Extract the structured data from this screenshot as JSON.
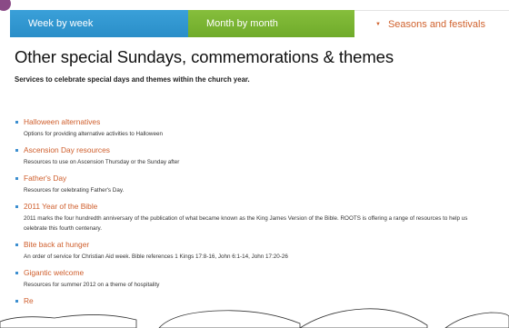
{
  "tabs": [
    {
      "label": "Week by week"
    },
    {
      "label": "Month by month"
    },
    {
      "label": "Seasons and festivals",
      "active": true
    }
  ],
  "page": {
    "title": "Other special Sundays, commemorations & themes",
    "intro": "Services to celebrate special days and themes within the church year."
  },
  "items": [
    {
      "title": "Halloween alternatives",
      "desc": "Options for providing alternative activities to Halloween"
    },
    {
      "title": "Ascension Day resources",
      "desc": "Resources to use on Ascension Thursday or the Sunday after"
    },
    {
      "title": "Father's Day",
      "desc": "Resources for celebrating Father's Day."
    },
    {
      "title": "2011 Year of the Bible",
      "desc": "2011 marks the four hundredth anniversary of the publication of what became known as the King James Version of the Bible. ROOTS is offering a range of resources to help us celebrate this fourth centenary."
    },
    {
      "title": "Bite back at hunger",
      "desc": "An order of service for Christian Aid week. Bible references 1 Kings 17:8-16, John 6:1-14, John 17:20-26"
    },
    {
      "title": "Gigantic welcome",
      "desc": "Resources for summer 2012 on a theme of hospitality"
    },
    {
      "title": "Re",
      "desc": ""
    }
  ],
  "colors": {
    "tab_week": "#2a8ec8",
    "tab_month": "#6fab2a",
    "link": "#cf5e2c",
    "bullet": "#3d8fd0"
  },
  "icons": {
    "active_tab": "down-triangle-icon"
  }
}
